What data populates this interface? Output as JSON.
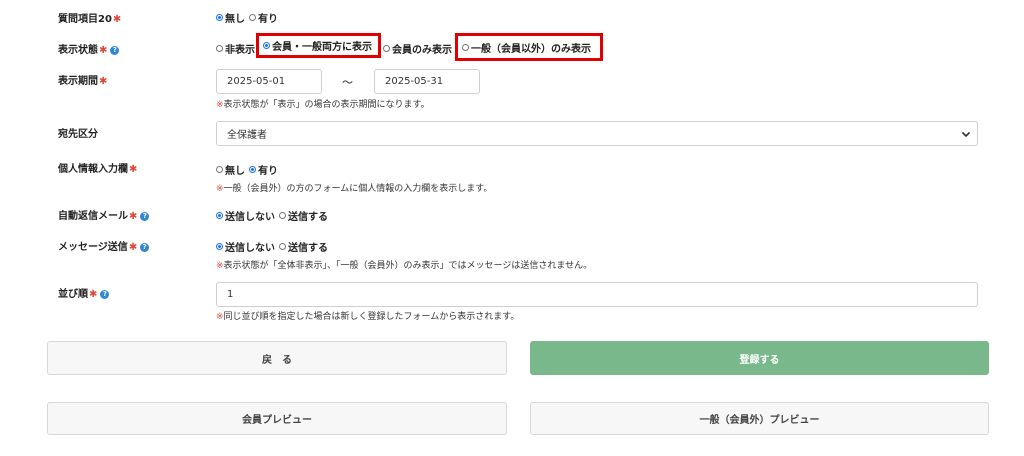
{
  "rows": {
    "q20": {
      "label": "質問項目20",
      "req": "✱",
      "options": [
        "無し",
        "有り"
      ],
      "selected": 0
    },
    "display_status": {
      "label": "表示状態",
      "req": "✱",
      "help": "?",
      "options": [
        "非表示",
        "会員・一般両方に表示",
        "会員のみ表示",
        "一般（会員以外）のみ表示"
      ],
      "selected": 1
    },
    "display_period": {
      "label": "表示期間",
      "req": "✱",
      "start": "2025-05-01",
      "separator": "〜",
      "end": "2025-05-31",
      "note_mark": "※",
      "note": "表示状態が「表示」の場合の表示期間になります。"
    },
    "recipient": {
      "label": "宛先区分",
      "value": "全保護者"
    },
    "personal_info": {
      "label": "個人情報入力欄",
      "req": "✱",
      "options": [
        "無し",
        "有り"
      ],
      "selected": 1,
      "note_mark": "※",
      "note": "一般（会員外）の方のフォームに個人情報の入力欄を表示します。"
    },
    "auto_mail": {
      "label": "自動返信メール",
      "req": "✱",
      "help": "?",
      "options": [
        "送信しない",
        "送信する"
      ],
      "selected": 0
    },
    "message_send": {
      "label": "メッセージ送信",
      "req": "✱",
      "help": "?",
      "options": [
        "送信しない",
        "送信する"
      ],
      "selected": 0,
      "note_mark": "※",
      "note": "表示状態が「全体非表示」、「一般（会員外）のみ表示」ではメッセージは送信されません。"
    },
    "sort_order": {
      "label": "並び順",
      "req": "✱",
      "help": "?",
      "value": "1",
      "note_mark": "※",
      "note": "同じ並び順を指定した場合は新しく登録したフォームから表示されます。"
    }
  },
  "buttons": {
    "back": "戻　る",
    "register": "登録する",
    "member_preview": "会員プレビュー",
    "general_preview": "一般（会員外）プレビュー"
  },
  "colors": {
    "required": "#e0483a",
    "primary_button": "#78b88a",
    "highlight": "#e00000",
    "help": "#2f86d6"
  }
}
